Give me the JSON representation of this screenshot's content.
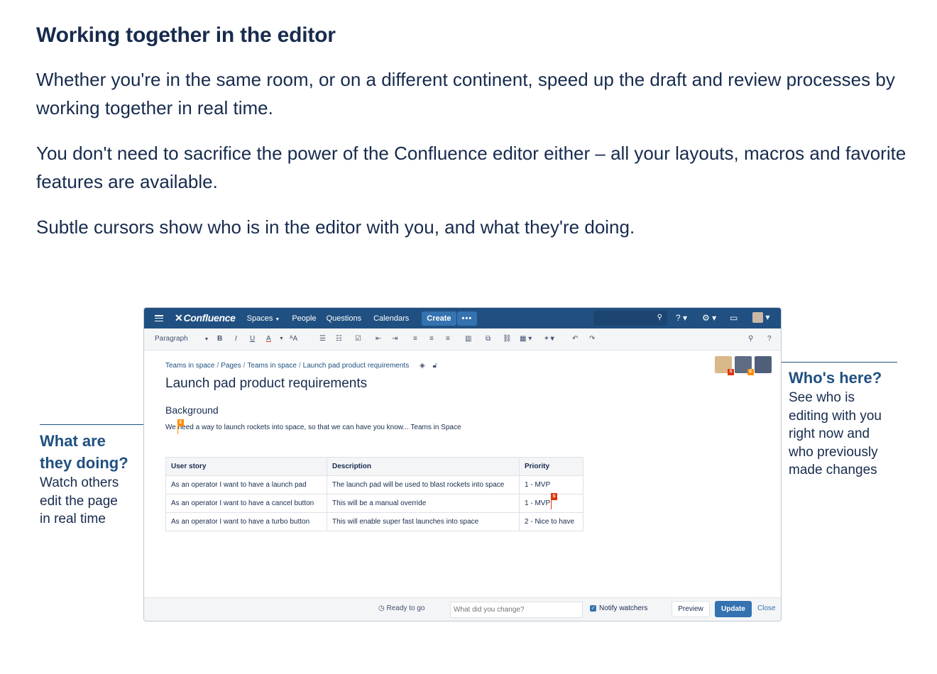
{
  "article": {
    "heading": "Working together in the editor",
    "paragraphs": [
      "Whether you're in the same room, or on a different continent, speed up the draft and review processes by working together in real time.",
      "You don't need to sacrifice the power of the Confluence editor either – all your layouts, macros and favorite features are available.",
      "Subtle cursors show who is in the editor with you, and what they're doing."
    ]
  },
  "callouts": {
    "left": {
      "title_line1": "What are",
      "title_line2": "they doing?",
      "text_lines": [
        "Watch others",
        "edit the page",
        "in real time"
      ]
    },
    "right": {
      "title": "Who's here?",
      "text_lines": [
        "See who is",
        "editing with you",
        "right now and",
        "who previously",
        "made changes"
      ]
    }
  },
  "app": {
    "logo": "Confluence",
    "nav": {
      "spaces": "Spaces",
      "people": "People",
      "questions": "Questions",
      "calendars": "Calendars",
      "create": "Create",
      "more": "•••"
    },
    "toolbar": {
      "paragraph": "Paragraph",
      "bold": "B",
      "italic": "I",
      "underline": "U",
      "color": "A",
      "size": "ᴬA"
    },
    "breadcrumb": [
      "Teams in space",
      "Pages",
      "Teams in space",
      "Launch pad product requirements"
    ],
    "page_title": "Launch pad product requirements",
    "section_heading": "Background",
    "body_line": "We need a way to launch rockets into space, so that we can have you know... Teams in Space",
    "cursor_labels": {
      "body": "E",
      "table": "S"
    },
    "table": {
      "headers": [
        "User story",
        "Description",
        "Priority"
      ],
      "rows": [
        [
          "As an operator I want to have a launch pad",
          "The launch pad will be used to blast rockets into space",
          "1 - MVP"
        ],
        [
          "As an operator I want to have a cancel button",
          "This will be a manual override",
          "1 - MVP"
        ],
        [
          "As an operator I want to have a turbo button",
          "This will enable super fast launches into space",
          "2 - Nice to have"
        ]
      ]
    },
    "avatar_badges": [
      "S",
      "E"
    ],
    "footer": {
      "status": "Ready to go",
      "change_placeholder": "What did you change?",
      "notify": "Notify watchers",
      "preview": "Preview",
      "update": "Update",
      "close": "Close"
    }
  }
}
